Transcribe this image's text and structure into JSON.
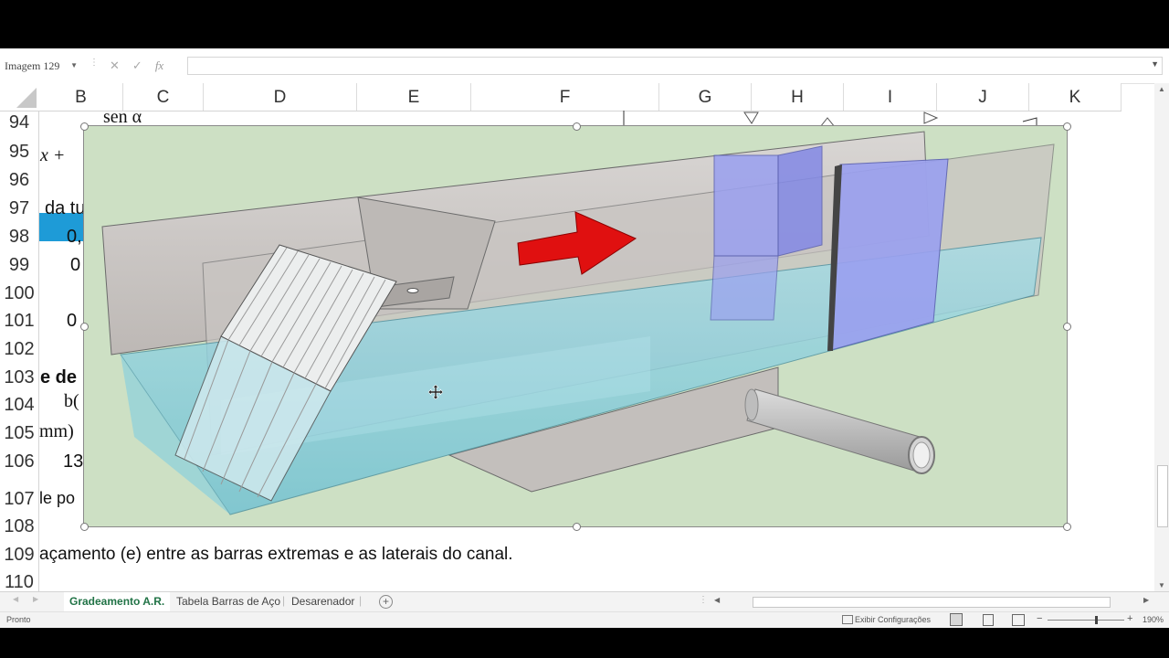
{
  "formula_bar": {
    "name_box": "Imagem 129",
    "cancel_icon": "✕",
    "enter_icon": "✓",
    "fx_label": "fx",
    "formula": ""
  },
  "columns": [
    "B",
    "C",
    "D",
    "E",
    "F",
    "G",
    "H",
    "I",
    "J",
    "K"
  ],
  "rows": [
    "94",
    "95",
    "96",
    "97",
    "98",
    "99",
    "100",
    "101",
    "102",
    "103",
    "104",
    "105",
    "106",
    "107",
    "108",
    "109",
    "110"
  ],
  "cells": {
    "r94": "sen α",
    "r95": "x  +",
    "r97": "da tu",
    "r98": "0,",
    "r99": "0",
    "r101": "0",
    "r103": "e de",
    "r104": "b(",
    "r105": "mm)",
    "r106": "13",
    "r107": "le po",
    "r109": "açamento (e) entre as barras extremas e as laterais do canal."
  },
  "sheet_tabs": [
    "Gradeamento A.R.",
    "Tabela Barras de Aço",
    "Desarenador"
  ],
  "active_tab": "Gradeamento A.R.",
  "status": {
    "ready": "Pronto",
    "display_settings": "Exibir Configurações",
    "zoom_minus": "−",
    "zoom_plus": "+",
    "zoom": "190%"
  },
  "colors": {
    "accent": "#217346",
    "selected_cell": "#1e9bd7",
    "picture_bg": "#cde0c4",
    "arrow": "#e01010",
    "gate": "#9aa0f0",
    "water": "#7ec9d8"
  },
  "icons": [
    "cancel-icon",
    "enter-icon",
    "fx-icon",
    "grid-view-icon",
    "page-layout-icon",
    "page-break-icon",
    "move-cursor-icon"
  ]
}
